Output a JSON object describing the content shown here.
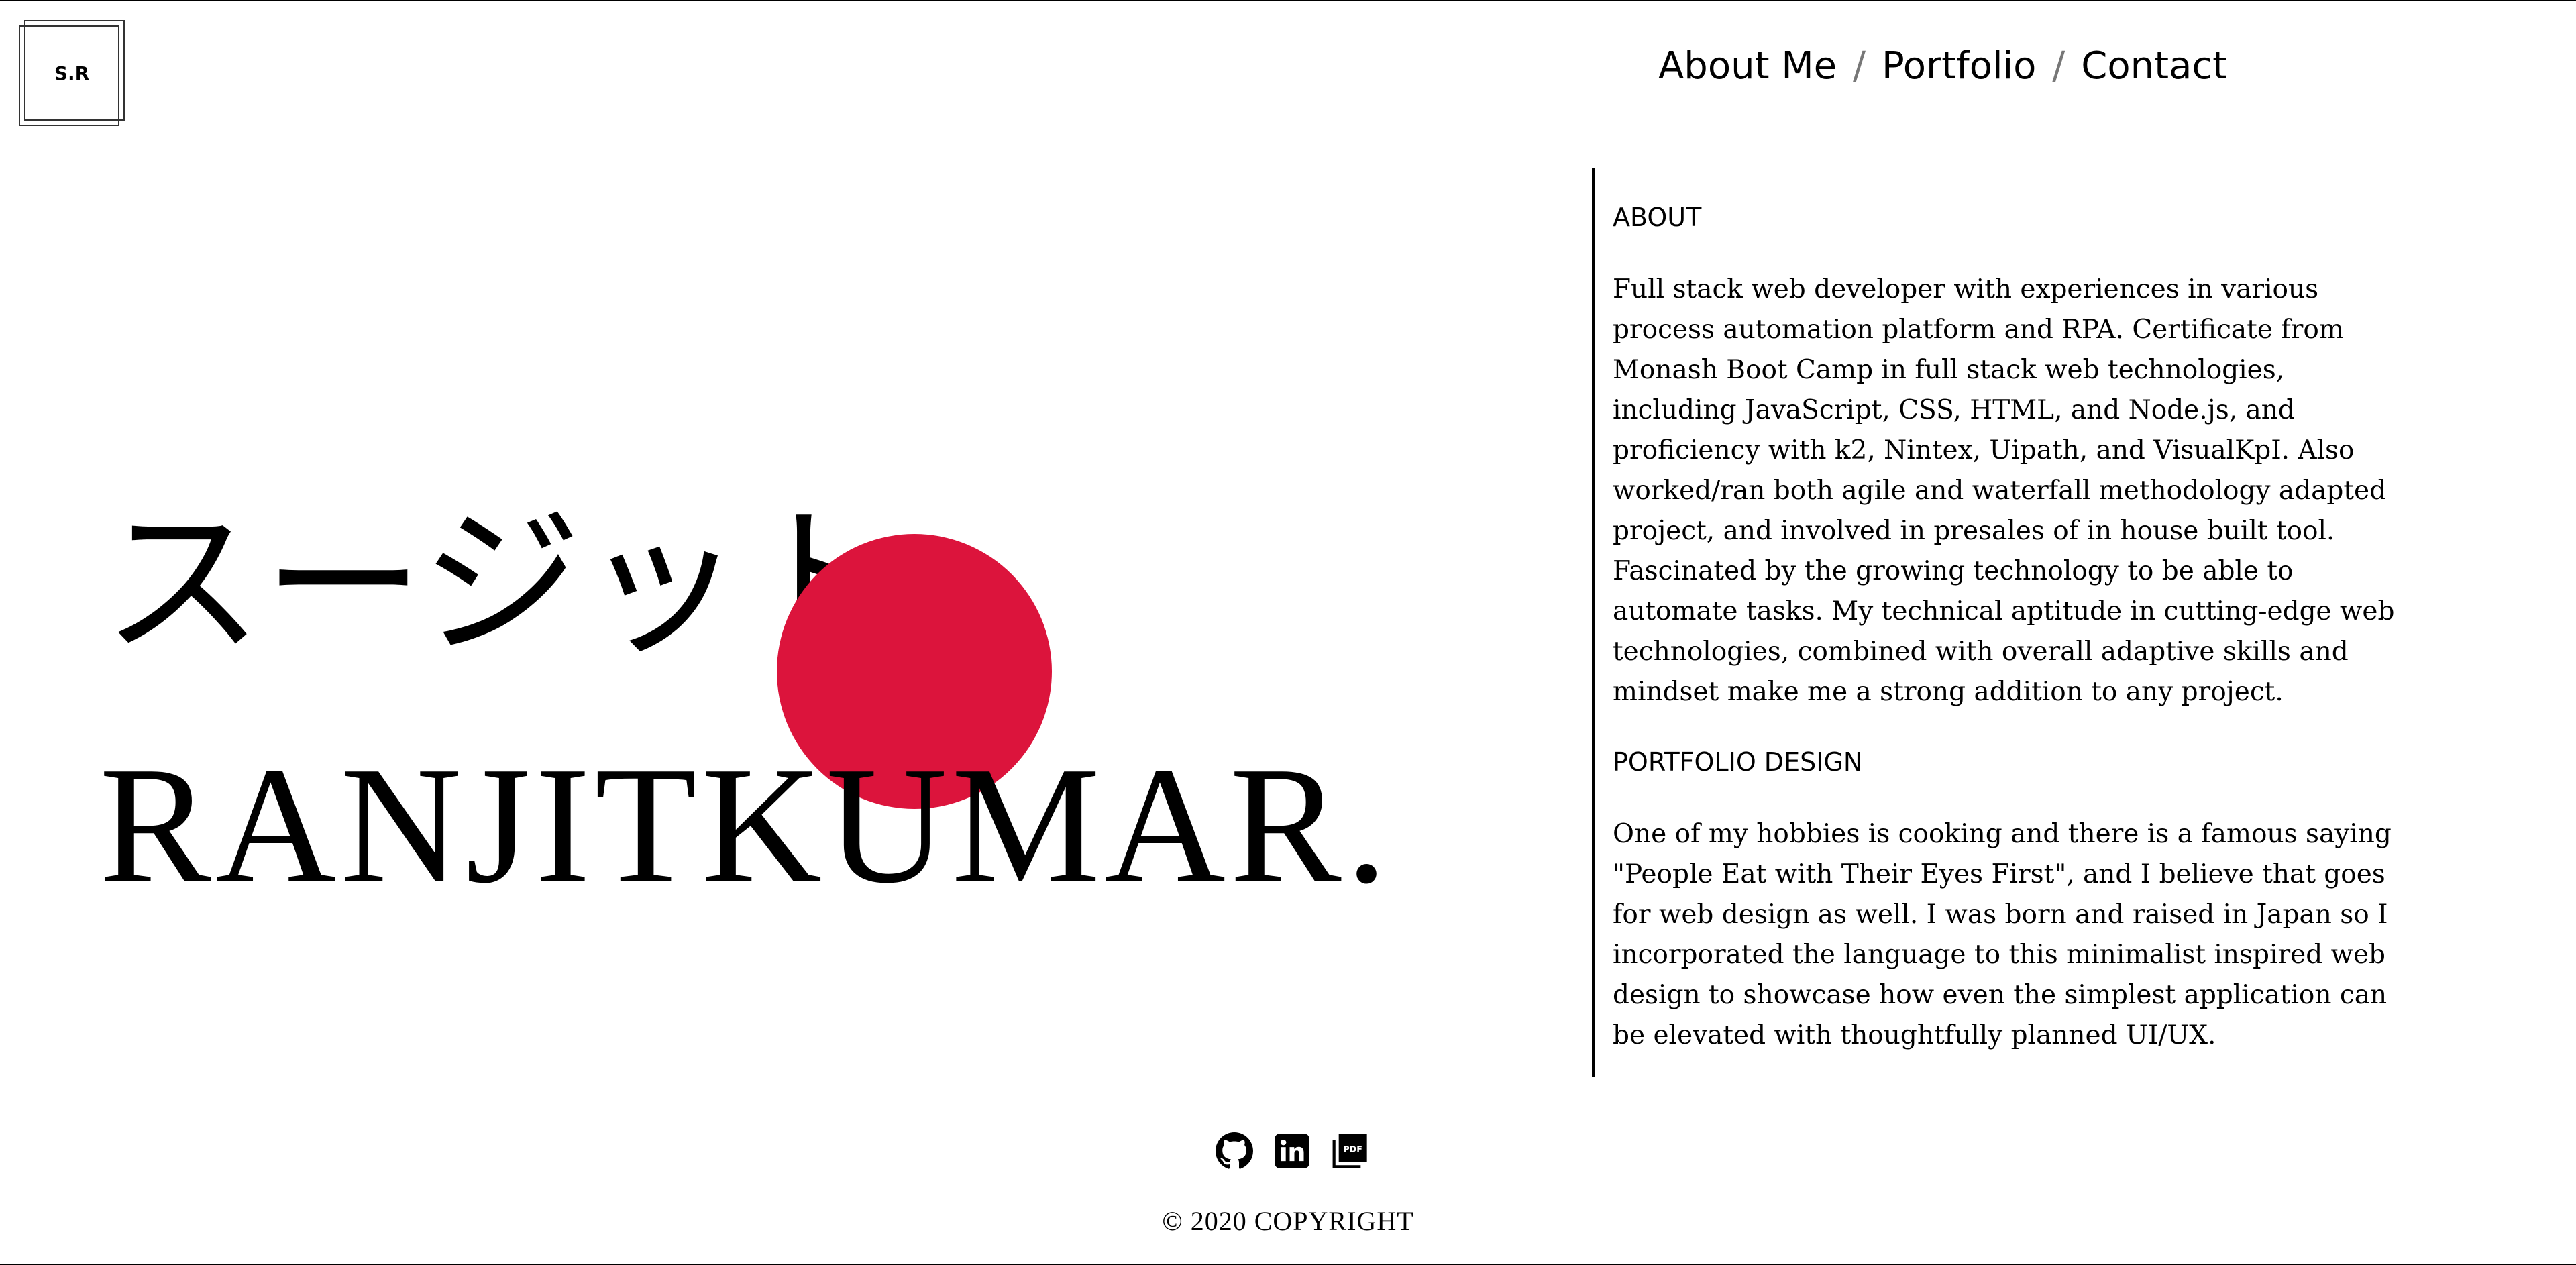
{
  "logo": {
    "text": "S.R"
  },
  "nav": {
    "items": [
      "About Me",
      "Portfolio",
      "Contact"
    ],
    "separator": "/"
  },
  "hero": {
    "japanese_name": "スージット",
    "surname": "RANJITKUMAR.",
    "circle_color": "#dc143c"
  },
  "about": {
    "heading": "ABOUT",
    "text": "Full stack web developer with experiences in various process automation platform and RPA. Certificate from Monash Boot Camp in full stack web technologies, including JavaScript, CSS, HTML, and Node.js, and proficiency with k2, Nintex, Uipath, and VisualKpI. Also worked/ran both agile and waterfall methodology adapted project, and involved in presales of in house built tool. Fascinated by the growing technology to be able to automate tasks. My technical aptitude in cutting-edge web technologies, combined with overall adaptive skills and mindset make me a strong addition to any project."
  },
  "portfolio_design": {
    "heading": "PORTFOLIO DESIGN",
    "text": "One of my hobbies is cooking and there is a famous saying \"People Eat with Their Eyes First\", and I believe that goes for web design as well. I was born and raised in Japan so I incorporated the language to this minimalist inspired web design to showcase how even the simplest application can be elevated with thoughtfully planned UI/UX."
  },
  "footer": {
    "icons": [
      "github-icon",
      "linkedin-icon",
      "pdf-icon"
    ],
    "icon_labels": [
      "PDF"
    ],
    "copyright": "© 2020 COPYRIGHT"
  }
}
